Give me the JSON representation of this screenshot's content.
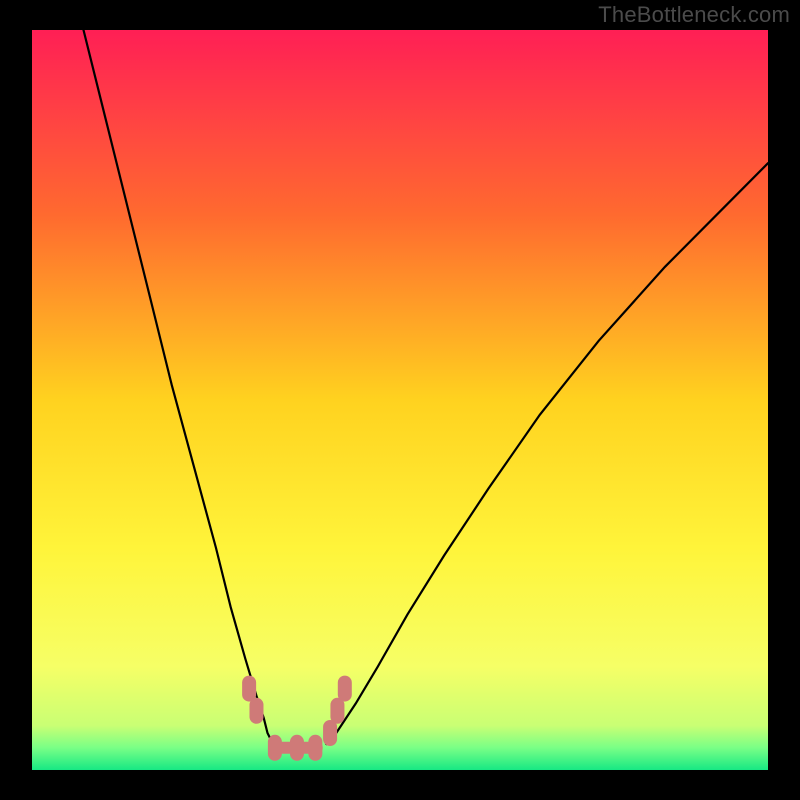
{
  "watermark": "TheBottleneck.com",
  "chart_data": {
    "type": "line",
    "title": "",
    "xlabel": "",
    "ylabel": "",
    "xlim": [
      0,
      100
    ],
    "ylim": [
      0,
      100
    ],
    "background_gradient": [
      {
        "stop": 0.0,
        "color": "#ff1f55"
      },
      {
        "stop": 0.25,
        "color": "#ff6a2f"
      },
      {
        "stop": 0.5,
        "color": "#ffd21f"
      },
      {
        "stop": 0.7,
        "color": "#fff43a"
      },
      {
        "stop": 0.86,
        "color": "#f6ff66"
      },
      {
        "stop": 0.94,
        "color": "#c9ff74"
      },
      {
        "stop": 0.97,
        "color": "#79ff86"
      },
      {
        "stop": 1.0,
        "color": "#17e884"
      }
    ],
    "series": [
      {
        "name": "curve-left",
        "stroke": "#000000",
        "x": [
          7,
          10,
          13,
          16,
          19,
          22,
          25,
          27,
          29,
          30.5,
          31.5,
          32,
          32.5,
          33
        ],
        "y": [
          100,
          88,
          76,
          64,
          52,
          41,
          30,
          22,
          15,
          10,
          7,
          5,
          4,
          3.5
        ]
      },
      {
        "name": "curve-right",
        "stroke": "#000000",
        "x": [
          40,
          41,
          42,
          44,
          47,
          51,
          56,
          62,
          69,
          77,
          86,
          95,
          100
        ],
        "y": [
          3.5,
          4.5,
          6,
          9,
          14,
          21,
          29,
          38,
          48,
          58,
          68,
          77,
          82
        ]
      },
      {
        "name": "bottom-marks",
        "stroke": "#cf7a78",
        "type": "scatter",
        "x": [
          29.5,
          30.5,
          33,
          36,
          38.5,
          40.5,
          41.5,
          42.5
        ],
        "y": [
          11,
          8,
          3,
          3,
          3,
          5,
          8,
          11
        ]
      }
    ]
  }
}
